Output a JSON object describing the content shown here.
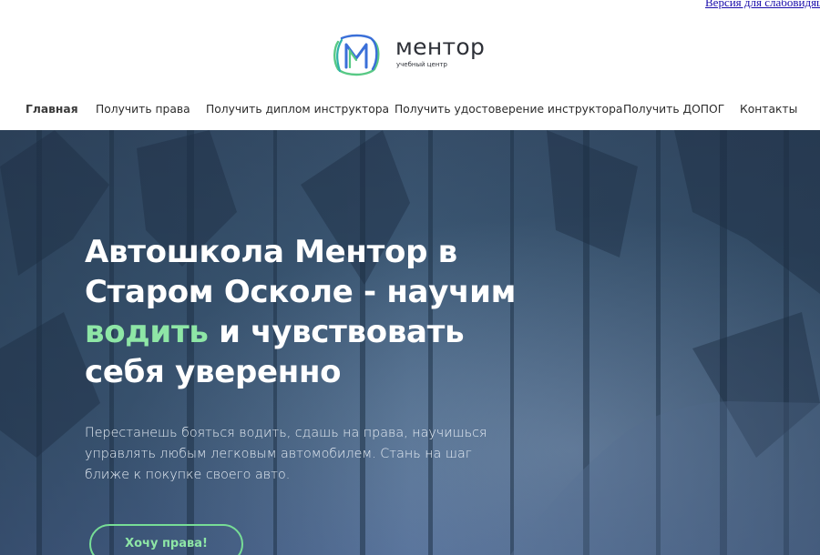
{
  "top": {
    "accessibility_link": "Версия для слабовидящих"
  },
  "logo": {
    "name": "ментор",
    "subtitle": "учебный центр",
    "mark_icon": "m-monogram-icon",
    "colors": {
      "blue": "#3a6fd8",
      "green": "#58c985",
      "teal": "#2fb3a8"
    }
  },
  "nav": {
    "items": [
      {
        "label": "Главная",
        "active": true
      },
      {
        "label": "Получить права"
      },
      {
        "label": "Получить диплом инструктора"
      },
      {
        "label": "Получить удостоверение инструктора"
      },
      {
        "label": "Получить ДОПОГ"
      },
      {
        "label": "Контакты"
      }
    ]
  },
  "hero": {
    "title_line1": "Автошкола Ментор в",
    "title_line2": "Старом Осколе - научим",
    "title_accent": "водить",
    "title_line3_rest": " и чувствовать",
    "title_line4": "себя уверенно",
    "text": "Перестанешь бояться водить, сдашь на права, научишься управлять любым легковым автомобилем. Стань на шаг ближе к покупке своего авто.",
    "cta_label": "Хочу права!",
    "accent_color": "#8ee6a6",
    "background_image": "misty-forest-road"
  }
}
